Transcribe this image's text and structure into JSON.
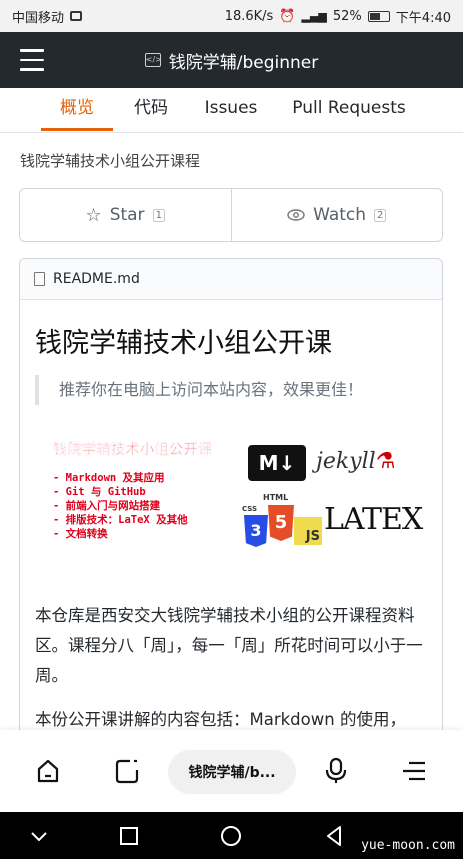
{
  "status_bar": {
    "carrier": "中国移动",
    "speed": "18.6K/s",
    "network": "4G",
    "battery": "52%",
    "time": "下午4:40"
  },
  "header": {
    "repo_title": "钱院学辅/beginner"
  },
  "tabs": [
    {
      "label": "概览",
      "active": true
    },
    {
      "label": "代码",
      "active": false
    },
    {
      "label": "Issues",
      "active": false
    },
    {
      "label": "Pull Requests",
      "active": false
    }
  ],
  "repo": {
    "description": "钱院学辅技术小组公开课程",
    "star_label": "Star",
    "star_count": "1",
    "watch_label": "Watch",
    "watch_count": "2"
  },
  "readme": {
    "filename": "README.md",
    "title": "钱院学辅技术小组公开课",
    "quote": "推荐你在电脑上访问本站内容，效果更佳！",
    "banner": {
      "title": "钱院学辅技术小组公开课",
      "items": [
        "- Markdown 及其应用",
        "- Git 与 GitHub",
        "- 前端入门与网站搭建",
        "- 排版技术：LaTeX 及其他",
        "- 文档转换"
      ],
      "logos": [
        "M↓",
        "jekyll",
        "HTML",
        "CSS",
        "JS",
        "LATEX"
      ]
    },
    "paragraph1": "本仓库是西安交大钱院学辅技术小组的公开课程资料区。课程分八「周」，每一「周」所花时间可以小于一周。",
    "paragraph2": "本份公开课讲解的内容包括：Markdown 的使用，"
  },
  "browser_bar": {
    "tab_title": "钱院学辅/b..."
  },
  "watermark": "yue-moon.com",
  "colors": {
    "accent": "#e36209",
    "header_bg": "#24292e",
    "banner_red": "#e0001a"
  }
}
